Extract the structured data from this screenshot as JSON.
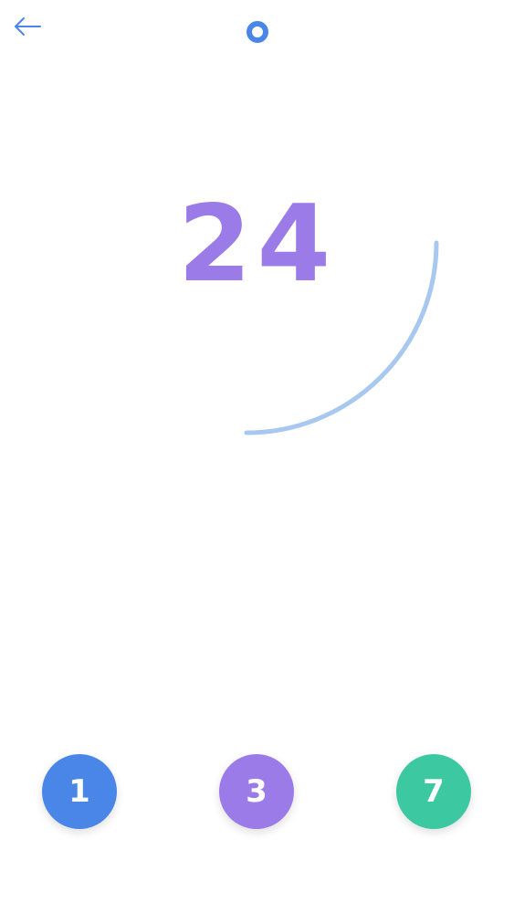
{
  "header": {
    "back_icon": "arrow-left-icon",
    "indicator_icon": "ring-dot-icon"
  },
  "game": {
    "target": "24",
    "timer_progress": 0.25
  },
  "choices": [
    {
      "label": "1",
      "color": "#4a86e8"
    },
    {
      "label": "3",
      "color": "#9b7be8"
    },
    {
      "label": "7",
      "color": "#3cc8a0"
    }
  ],
  "colors": {
    "accent_blue": "#4a86e8",
    "target_purple": "#9b7be8",
    "arc_blue": "#a9c8f0"
  }
}
